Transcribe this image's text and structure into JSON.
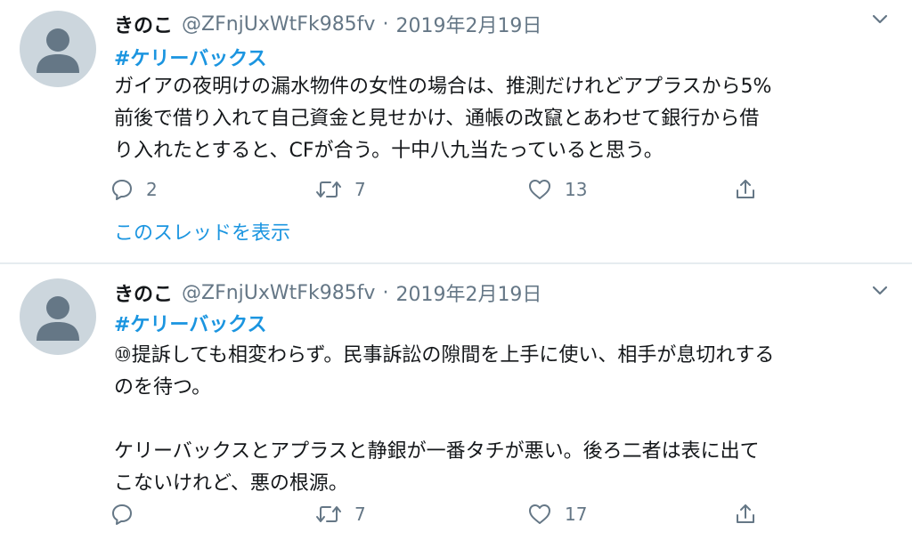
{
  "tweets": [
    {
      "name": "きのこ",
      "handle": "@ZFnjUxWtFk985fv",
      "separator": "·",
      "date": "2019年2月19日",
      "hashtag": "#ケリーバックス",
      "lines": [
        "ガイアの夜明けの漏水物件の女性の場合は、推測だけれどアプラスから5%",
        "前後で借り入れて自己資金と見せかけ、通帳の改竄とあわせて銀行から借",
        "り入れたとすると、CFが合う。十中八九当たっていると思う。"
      ],
      "reply_count": "2",
      "retweet_count": "7",
      "like_count": "13",
      "thread_link": "このスレッドを表示"
    },
    {
      "name": "きのこ",
      "handle": "@ZFnjUxWtFk985fv",
      "separator": "·",
      "date": "2019年2月19日",
      "hashtag": "#ケリーバックス",
      "lines": [
        "⑩提訴しても相変わらず。民事訴訟の隙間を上手に使い、相手が息切れする",
        "のを待つ。",
        "",
        "ケリーバックスとアプラスと静銀が一番タチが悪い。後ろ二者は表に出て",
        "こないけれど、悪の根源。"
      ],
      "reply_count": "",
      "retweet_count": "7",
      "like_count": "17"
    }
  ],
  "icons": {
    "avatar": "default-avatar-silhouette",
    "caret": "chevron-down-icon",
    "reply": "reply-icon",
    "retweet": "retweet-icon",
    "like": "heart-icon",
    "share": "share-icon"
  },
  "colors": {
    "link": "#1b95e0",
    "text": "#14171a",
    "muted": "#657786",
    "avatar_bg": "#ccd6dd",
    "avatar_fg": "#657786",
    "divider": "#e6ecf0"
  }
}
